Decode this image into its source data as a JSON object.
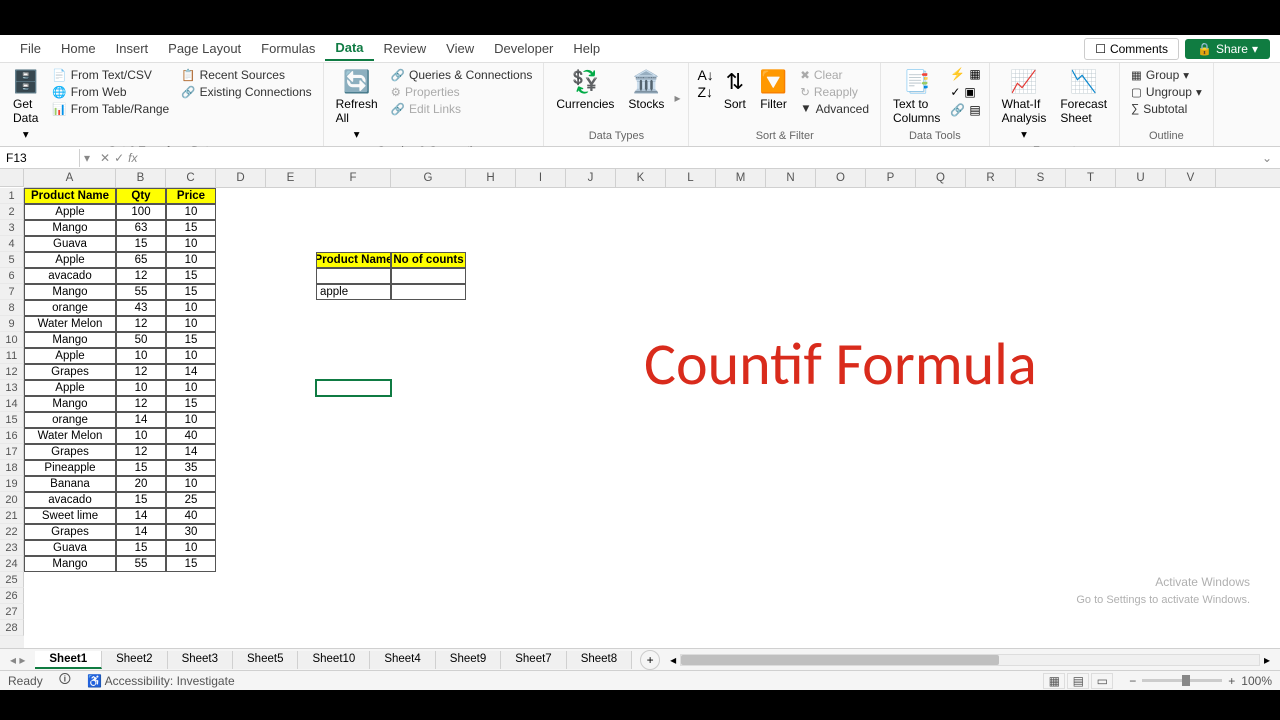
{
  "menu": {
    "tabs": [
      "File",
      "Home",
      "Insert",
      "Page Layout",
      "Formulas",
      "Data",
      "Review",
      "View",
      "Developer",
      "Help"
    ],
    "active": "Data",
    "comments": "Comments",
    "share": "Share"
  },
  "ribbon": {
    "getdata": {
      "get_data": "Get\nData",
      "text_csv": "From Text/CSV",
      "web": "From Web",
      "table": "From Table/Range",
      "recent": "Recent Sources",
      "existing": "Existing Connections",
      "label": "Get & Transform Data"
    },
    "queries": {
      "refresh": "Refresh\nAll",
      "qc": "Queries & Connections",
      "props": "Properties",
      "links": "Edit Links",
      "label": "Queries & Connections"
    },
    "types": {
      "cur": "Currencies",
      "stk": "Stocks",
      "label": "Data Types"
    },
    "sortfilter": {
      "sort": "Sort",
      "filter": "Filter",
      "clear": "Clear",
      "reapply": "Reapply",
      "advanced": "Advanced",
      "label": "Sort & Filter"
    },
    "tools": {
      "ttc": "Text to\nColumns",
      "label": "Data Tools"
    },
    "forecast": {
      "whatif": "What-If\nAnalysis",
      "sheet": "Forecast\nSheet",
      "label": "Forecast"
    },
    "outline": {
      "group": "Group",
      "ungroup": "Ungroup",
      "subtotal": "Subtotal",
      "label": "Outline"
    }
  },
  "namebox": "F13",
  "columns": [
    "A",
    "B",
    "C",
    "D",
    "E",
    "F",
    "G",
    "H",
    "I",
    "J",
    "K",
    "L",
    "M",
    "N",
    "O",
    "P",
    "Q",
    "R",
    "S",
    "T",
    "U",
    "V"
  ],
  "rowcount": 28,
  "main_table": {
    "headers": [
      "Product Name",
      "Qty",
      "Price"
    ],
    "rows": [
      [
        "Apple",
        "100",
        "10"
      ],
      [
        "Mango",
        "63",
        "15"
      ],
      [
        "Guava",
        "15",
        "10"
      ],
      [
        "Apple",
        "65",
        "10"
      ],
      [
        "avacado",
        "12",
        "15"
      ],
      [
        "Mango",
        "55",
        "15"
      ],
      [
        "orange",
        "43",
        "10"
      ],
      [
        "Water Melon",
        "12",
        "10"
      ],
      [
        "Mango",
        "50",
        "15"
      ],
      [
        "Apple",
        "10",
        "10"
      ],
      [
        "Grapes",
        "12",
        "14"
      ],
      [
        "Apple",
        "10",
        "10"
      ],
      [
        "Mango",
        "12",
        "15"
      ],
      [
        "orange",
        "14",
        "10"
      ],
      [
        "Water Melon",
        "10",
        "40"
      ],
      [
        "Grapes",
        "12",
        "14"
      ],
      [
        "Pineapple",
        "15",
        "35"
      ],
      [
        "Banana",
        "20",
        "10"
      ],
      [
        "avacado",
        "15",
        "25"
      ],
      [
        "Sweet lime",
        "14",
        "40"
      ],
      [
        "Grapes",
        "14",
        "30"
      ],
      [
        "Guava",
        "15",
        "10"
      ],
      [
        "Mango",
        "55",
        "15"
      ]
    ]
  },
  "side_table": {
    "headers": [
      "Product Name",
      "No of counts"
    ],
    "row2": [
      "apple",
      ""
    ]
  },
  "overlay": "Countif Formula",
  "watermark": {
    "l1": "Activate Windows",
    "l2": "Go to Settings to activate Windows."
  },
  "sheets": [
    "Sheet1",
    "Sheet2",
    "Sheet3",
    "Sheet5",
    "Sheet10",
    "Sheet4",
    "Sheet9",
    "Sheet7",
    "Sheet8"
  ],
  "status": {
    "ready": "Ready",
    "access": "Accessibility: Investigate",
    "zoom": "100%"
  }
}
